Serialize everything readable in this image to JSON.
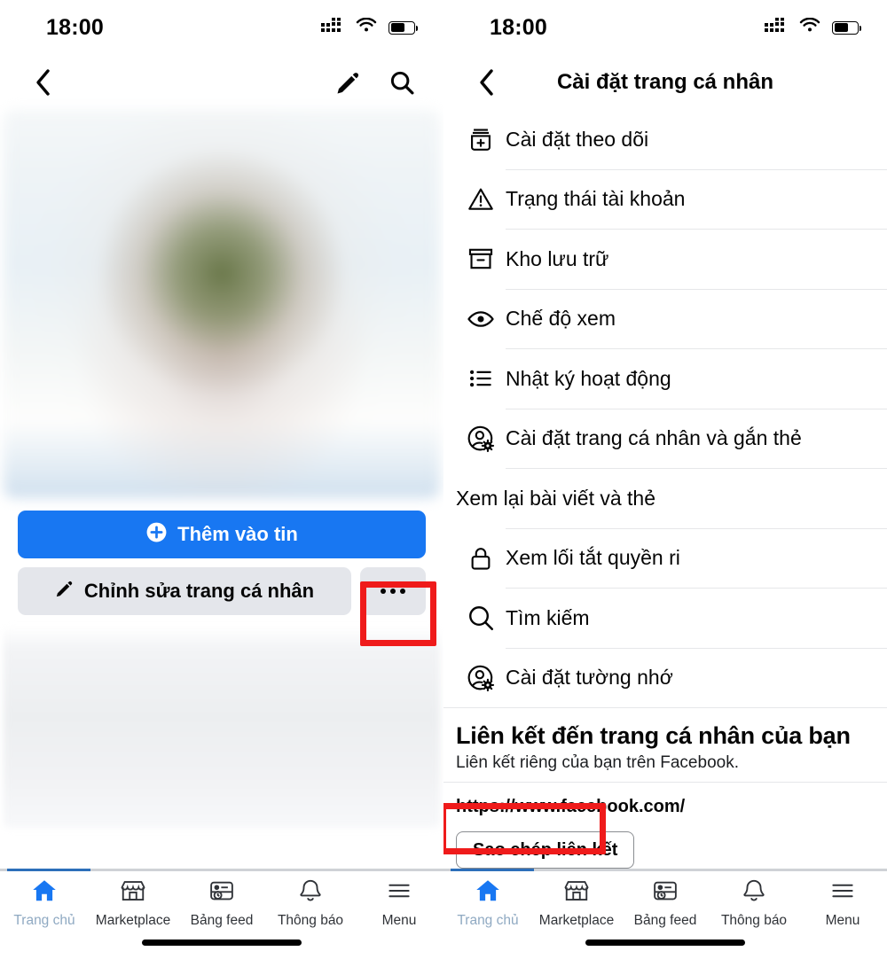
{
  "status_bar": {
    "time": "18:00",
    "battery_level": 62,
    "icons": [
      "cellular-signal-icon",
      "wifi-icon",
      "battery-icon"
    ]
  },
  "left_screen": {
    "nav": {
      "back_icon": "chevron-left-icon",
      "edit_icon": "pencil-icon",
      "search_icon": "search-icon"
    },
    "profile": {
      "add_to_story_label": "Thêm vào tin",
      "add_to_story_icon": "plus-circle-icon",
      "edit_profile_label": "Chỉnh sửa trang cá nhân",
      "edit_profile_icon": "pencil-icon",
      "more_icon": "ellipsis-icon"
    }
  },
  "right_screen": {
    "nav": {
      "back_icon": "chevron-left-icon",
      "title": "Cài đặt trang cá nhân"
    },
    "settings_items": [
      {
        "label": "Cài đặt theo dõi",
        "icon": "add-to-list-icon",
        "has_icon": true
      },
      {
        "label": "Trạng thái tài khoản",
        "icon": "warning-triangle-icon",
        "has_icon": true
      },
      {
        "label": "Kho lưu trữ",
        "icon": "archive-box-icon",
        "has_icon": true
      },
      {
        "label": "Chế độ xem",
        "icon": "eye-icon",
        "has_icon": true
      },
      {
        "label": "Nhật ký hoạt động",
        "icon": "activity-log-icon",
        "has_icon": true
      },
      {
        "label": "Cài đặt trang cá nhân và gắn thẻ",
        "icon": "profile-gear-icon",
        "has_icon": true
      },
      {
        "label": "Xem lại bài viết và thẻ",
        "icon": "",
        "has_icon": false
      },
      {
        "label": "Xem lối tắt quyền ri",
        "icon": "lock-icon",
        "has_icon": true
      },
      {
        "label": "Tìm kiếm",
        "icon": "search-icon",
        "has_icon": true
      },
      {
        "label": "Cài đặt tường nhớ",
        "icon": "profile-gear-icon",
        "has_icon": true
      }
    ],
    "profile_link": {
      "heading": "Liên kết đến trang cá nhân của bạn",
      "subtitle": "Liên kết riêng của bạn trên Facebook.",
      "url": "https://www.facebook.com/",
      "copy_button_label": "Sao chép liên kết"
    }
  },
  "tab_bar": {
    "items": [
      {
        "label": "Trang chủ",
        "icon": "home-icon",
        "active": true
      },
      {
        "label": "Marketplace",
        "icon": "storefront-icon",
        "active": false
      },
      {
        "label": "Bảng feed",
        "icon": "news-feed-icon",
        "active": false
      },
      {
        "label": "Thông báo",
        "icon": "bell-icon",
        "active": false
      },
      {
        "label": "Menu",
        "icon": "hamburger-menu-icon",
        "active": false
      }
    ]
  },
  "colors": {
    "brand_blue": "#1877f2",
    "highlight_red": "#ef1b1b",
    "secondary_grey": "#e4e6eb",
    "divider": "#e6e7e9"
  }
}
